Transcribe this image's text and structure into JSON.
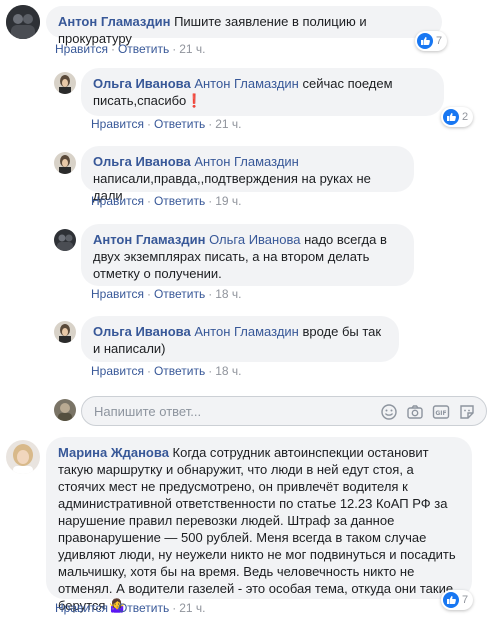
{
  "comments": [
    {
      "author": "Антон Гламаздин",
      "mention": "",
      "text": "Пишите заявление в полицию и прокуратуру",
      "like": "Нравится",
      "reply": "Ответить",
      "time": "21 ч.",
      "reactions": "7"
    },
    {
      "author": "Ольга Иванова",
      "mention": "Антон Гламаздин",
      "text": "сейчас поедем писать,спасибо",
      "emoji": "❗",
      "like": "Нравится",
      "reply": "Ответить",
      "time": "21 ч.",
      "reactions": "2"
    },
    {
      "author": "Ольга Иванова",
      "mention": "Антон Гламаздин",
      "text": "написали,правда,,подтверждения на руках не дали",
      "like": "Нравится",
      "reply": "Ответить",
      "time": "19 ч."
    },
    {
      "author": "Антон Гламаздин",
      "mention": "Ольга Иванова",
      "text": "надо всегда в двух экземплярах писать, а на втором делать отметку о получении.",
      "like": "Нравится",
      "reply": "Ответить",
      "time": "18 ч."
    },
    {
      "author": "Ольга Иванова",
      "mention": "Антон Гламаздин",
      "text": "вроде бы так и написали)",
      "like": "Нравится",
      "reply": "Ответить",
      "time": "18 ч."
    },
    {
      "author": "Марина Жданова",
      "mention": "",
      "text": "Когда сотрудник автоинспекции остановит такую маршрутку и обнаружит, что люди в ней едут стоя, а стоячих мест не предусмотрено, он привлечёт водителя к административной ответственности по статье 12.23 КоАП РФ за нарушение правил перевозки людей. Штраф за данное правонарушение — 500 рублей. Меня всегда в таком случае удивляют люди, ну неужели никто не мог подвинуться и посадить мальчишку, хотя бы на время. Ведь человечность никто не отменял. А водители газелей - это особая тема, откуда они такие берутся",
      "emoji": "🤷‍♀️",
      "like": "Нравится",
      "reply": "Ответить",
      "time": "21 ч.",
      "reactions": "7"
    }
  ],
  "reply_input": {
    "placeholder": "Напишите ответ..."
  },
  "icons": [
    "emoji-icon",
    "camera-icon",
    "gif-icon",
    "sticker-icon"
  ],
  "colors": {
    "link": "#385898",
    "bubble": "#f2f3f5",
    "meta": "#90949c",
    "like": "#1877f2"
  }
}
